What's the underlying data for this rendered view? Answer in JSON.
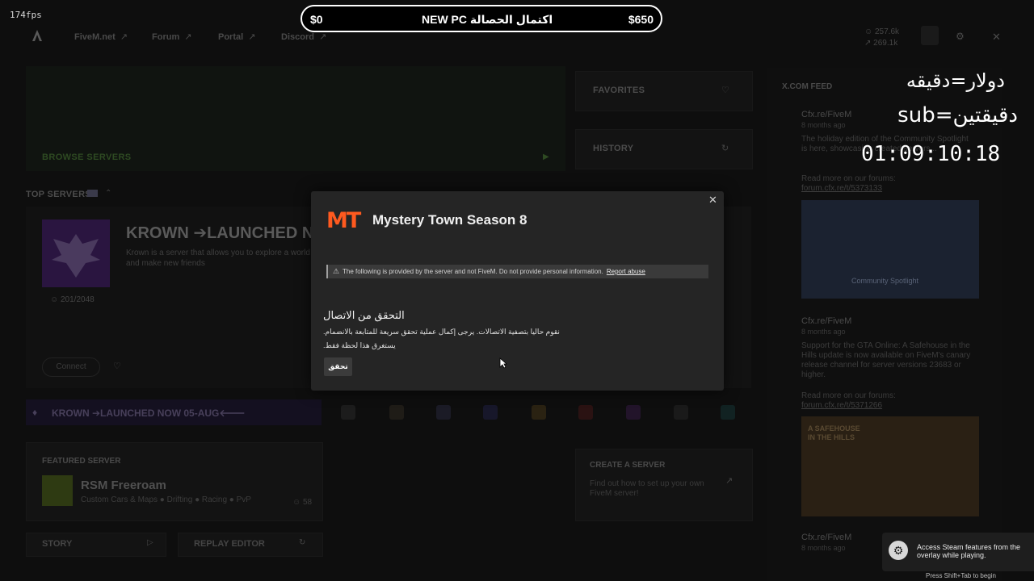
{
  "fps": "174fps",
  "nav": {
    "links": [
      {
        "label": "FiveM.net",
        "arrow": "↗"
      },
      {
        "label": "Forum",
        "arrow": "↗"
      },
      {
        "label": "Portal",
        "arrow": "↗"
      },
      {
        "label": "Discord",
        "arrow": "↗"
      }
    ],
    "stats": [
      "257.6k",
      "269.1k"
    ]
  },
  "home": {
    "browse_servers": "BROWSE SERVERS",
    "favorites": "FAVORITES",
    "history": "HISTORY",
    "top_servers": "TOP SERVERS",
    "top_server": {
      "title": "KROWN ➔LAUNCHED N",
      "desc": "Krown is a server that allows you to explore a world and make new friends",
      "players": "201/2048",
      "connect": "Connect"
    },
    "banner_text": "KROWN ➔LAUNCHED NOW 05-AUG🡐",
    "featured": {
      "label": "FEATURED SERVER",
      "title": "RSM Freeroam",
      "tags": "Custom Cars & Maps ● Drifting ● Racing ● PvP",
      "count": "58"
    },
    "story": "STORY",
    "replay": "REPLAY EDITOR",
    "create": {
      "title": "CREATE A SERVER",
      "desc": "Find out how to set up your own FiveM server!"
    }
  },
  "feed": {
    "title": "X.COM FEED",
    "posts": [
      {
        "author": "Cfx.re/FiveM",
        "time": "8 months ago",
        "body": "The holiday edition of the Community Spotlight is here, showcasing created servers...",
        "more": "Read more on our forums:",
        "link": "forum.cfx.re/t/5373133",
        "image_caption": "Community Spotlight"
      },
      {
        "author": "Cfx.re/FiveM",
        "time": "8 months ago",
        "body": "Support for the GTA Online: A Safehouse in the Hills update is now available on FiveM's canary release channel for server versions 23683 or higher.",
        "more": "Read more on our forums:",
        "link": "forum.cfx.re/t/5371266",
        "image_caption": "A SAFEHOUSE IN THE HILLS"
      },
      {
        "author": "Cfx.re/FiveM",
        "time": "8 months ago"
      }
    ]
  },
  "goal": {
    "start": "$0",
    "label": "اكتمال الحصالة NEW PC",
    "target": "$650"
  },
  "streamer": {
    "line1": "دولار=دقيقه",
    "line2": "sub=دقيقتين",
    "timer": "01:09:10:18"
  },
  "steam": {
    "text": "Access Steam features from the overlay while playing.",
    "hint": "Press Shift+Tab to begin"
  },
  "modal": {
    "title": "Mystery Town Season 8",
    "logo_text": "MT",
    "notice": "The following is provided by the server and not FiveM. Do not provide personal information.",
    "report": "Report abuse",
    "heading": "التحقق من الاتصال",
    "line1": "نقوم حاليا بتصفية الاتصالات. يرجى إكمال عملية تحقق سريعة للمتابعة بالانضمام.",
    "line2": "يستغرق هذا لحظة فقط.",
    "button": "تحقق"
  },
  "colors": {
    "accent_logo": "#ff5a1f",
    "modal_bg": "#252525",
    "background": "#0e0e0e"
  }
}
